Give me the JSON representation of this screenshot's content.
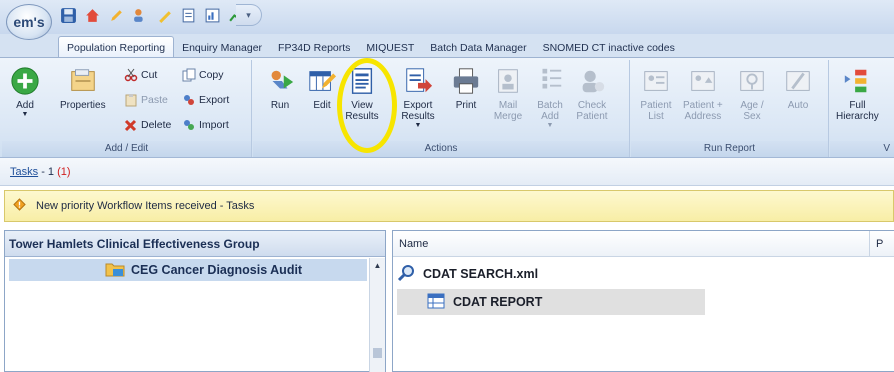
{
  "app": {
    "orb_label": "em's"
  },
  "tabs": [
    {
      "label": "Population Reporting",
      "active": true
    },
    {
      "label": "Enquiry Manager"
    },
    {
      "label": "FP34D Reports"
    },
    {
      "label": "MIQUEST"
    },
    {
      "label": "Batch Data Manager"
    },
    {
      "label": "SNOMED CT inactive codes"
    }
  ],
  "ribbon": {
    "add_edit": {
      "label": "Add / Edit",
      "add": "Add",
      "properties": "Properties",
      "cut": "Cut",
      "copy": "Copy",
      "paste": "Paste",
      "export": "Export",
      "delete": "Delete",
      "import": "Import"
    },
    "actions": {
      "label": "Actions",
      "run": "Run",
      "edit": "Edit",
      "view_results_1": "View",
      "view_results_2": "Results",
      "export_results_1": "Export",
      "export_results_2": "Results",
      "print": "Print",
      "mail_merge_1": "Mail",
      "mail_merge_2": "Merge",
      "batch_add_1": "Batch",
      "batch_add_2": "Add",
      "check_patient_1": "Check",
      "check_patient_2": "Patient"
    },
    "run_report": {
      "label": "Run Report",
      "patient_list_1": "Patient",
      "patient_list_2": "List",
      "patient_address_1": "Patient +",
      "patient_address_2": "Address",
      "age_sex_1": "Age /",
      "age_sex_2": "Sex",
      "auto": "Auto"
    },
    "view": {
      "label": "V",
      "full_hierarchy_1": "Full",
      "full_hierarchy_2": "Hierarchy"
    }
  },
  "tasks": {
    "link": "Tasks",
    "count": "- 1",
    "new": "(1)"
  },
  "notification": "New priority Workflow Items received - Tasks",
  "left_pane": {
    "title": "Tower Hamlets Clinical Effectiveness Group",
    "selected_folder": "CEG Cancer Diagnosis Audit"
  },
  "right_pane": {
    "col_name": "Name",
    "col_2": "P",
    "items": [
      {
        "name": "CDAT SEARCH.xml",
        "icon": "search-icon"
      },
      {
        "name": "CDAT REPORT",
        "icon": "report-icon"
      }
    ]
  },
  "colors": {
    "highlight": "#f7e500",
    "accent": "#1f4f9a"
  }
}
